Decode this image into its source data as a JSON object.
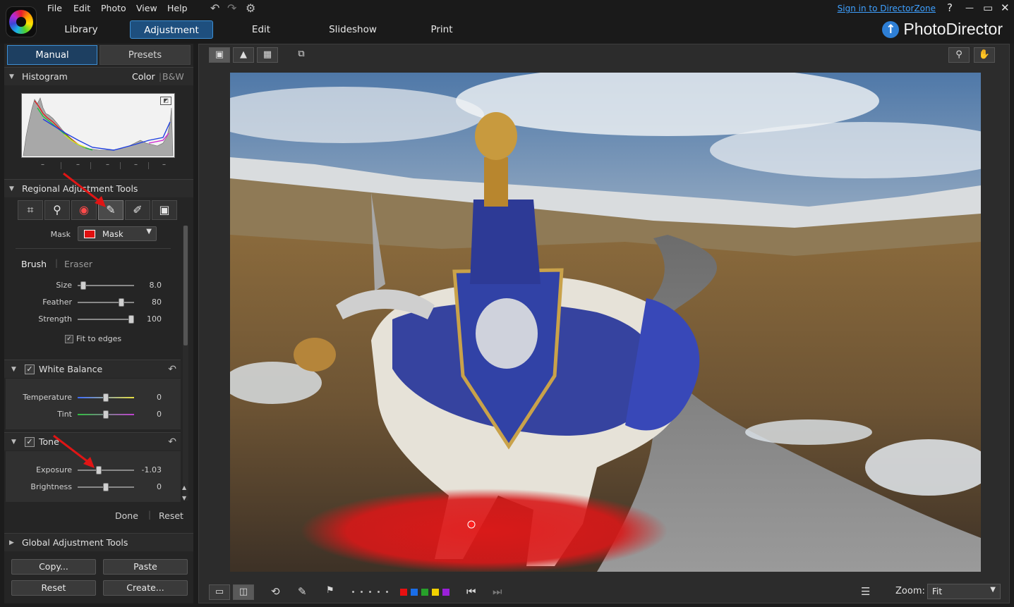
{
  "menu": {
    "file": "File",
    "edit": "Edit",
    "photo": "Photo",
    "view": "View",
    "help": "Help"
  },
  "title_bar": {
    "sign_in": "Sign in to DirectorZone",
    "help_glyph": "?",
    "minimize_glyph": "—",
    "maximize_glyph": "▭",
    "close_glyph": "✕"
  },
  "modules": {
    "library": "Library",
    "adjustment": "Adjustment",
    "edit": "Edit",
    "slideshow": "Slideshow",
    "print": "Print"
  },
  "brand": {
    "name": "PhotoDirector"
  },
  "mode_tabs": {
    "manual": "Manual",
    "presets": "Presets"
  },
  "histogram": {
    "title": "Histogram",
    "color": "Color",
    "bw": "B&W",
    "ticks": [
      "–",
      "–",
      "–",
      "–",
      "–"
    ]
  },
  "regional": {
    "title": "Regional Adjustment Tools",
    "mask_label": "Mask",
    "mask_value": "Mask",
    "brush_tab": "Brush",
    "eraser_tab": "Eraser",
    "sliders": [
      {
        "label": "Size",
        "value": "8.0",
        "pos": 0.08
      },
      {
        "label": "Feather",
        "value": "80",
        "pos": 0.8
      },
      {
        "label": "Strength",
        "value": "100",
        "pos": 1.0
      }
    ],
    "fit_to_edges": "Fit to edges"
  },
  "white_balance": {
    "title": "White Balance",
    "sliders": [
      {
        "label": "Temperature",
        "value": "0",
        "pos": 0.5
      },
      {
        "label": "Tint",
        "value": "0",
        "pos": 0.5
      }
    ]
  },
  "tone": {
    "title": "Tone",
    "sliders": [
      {
        "label": "Exposure",
        "value": "-1.03",
        "pos": 0.37
      },
      {
        "label": "Brightness",
        "value": "0",
        "pos": 0.5
      }
    ]
  },
  "actions": {
    "done": "Done",
    "reset": "Reset"
  },
  "global": {
    "title": "Global Adjustment Tools",
    "copy": "Copy...",
    "paste": "Paste",
    "reset": "Reset",
    "create": "Create..."
  },
  "bottom": {
    "zoom_label": "Zoom:",
    "zoom_value": "Fit"
  },
  "colors": {
    "accent": "#3d8fd4",
    "mask_red": "#e01010",
    "label_chips": [
      "#e81010",
      "#1a6ee8",
      "#27a02a",
      "#f0d000",
      "#9a20d8"
    ]
  }
}
